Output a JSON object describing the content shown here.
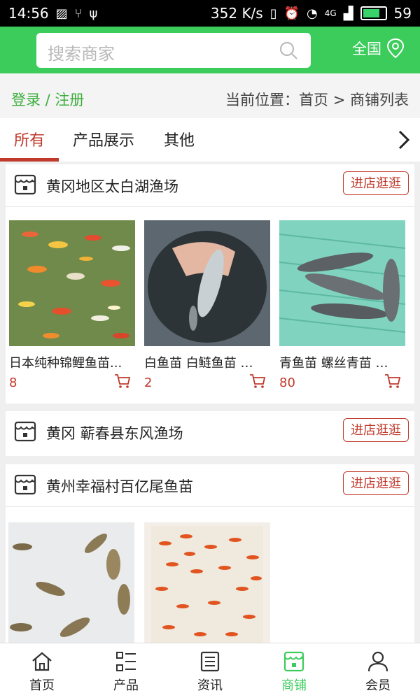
{
  "status_bar": {
    "time": "14:56",
    "network_speed": "352 K/s",
    "network_type": "4G",
    "battery": "59"
  },
  "header": {
    "search_placeholder": "搜索商家",
    "region_label": "全国"
  },
  "breadcrumb": {
    "login_label": "登录 / 注册",
    "location": "当前位置：首页 > 商铺列表"
  },
  "tabs": [
    {
      "label": "所有",
      "active": true
    },
    {
      "label": "产品展示"
    },
    {
      "label": "其他"
    }
  ],
  "shops": [
    {
      "name": "黄冈地区太白湖渔场",
      "visit_label": "进店逛逛",
      "products": [
        {
          "title": "日本纯种锦鲤鱼苗...",
          "price": "8"
        },
        {
          "title": "白鱼苗 白鲢鱼苗 鳙...",
          "price": "2"
        },
        {
          "title": "青鱼苗 螺丝青苗 锦...",
          "price": "80"
        }
      ]
    },
    {
      "name": "黄冈 蕲春县东风渔场",
      "visit_label": "进店逛逛",
      "products": []
    },
    {
      "name": "黄州幸福村百亿尾鱼苗",
      "visit_label": "进店逛逛",
      "products": [
        {
          "title": "",
          "price": ""
        },
        {
          "title": "",
          "price": ""
        }
      ]
    }
  ],
  "bottom_nav": [
    {
      "label": "首页",
      "icon": "home-icon"
    },
    {
      "label": "产品",
      "icon": "list-icon"
    },
    {
      "label": "资讯",
      "icon": "news-icon"
    },
    {
      "label": "商铺",
      "icon": "store-icon",
      "active": true
    },
    {
      "label": "会员",
      "icon": "user-icon"
    }
  ],
  "colors": {
    "accent_green": "#3ccc5c",
    "accent_red": "#c0392b"
  }
}
